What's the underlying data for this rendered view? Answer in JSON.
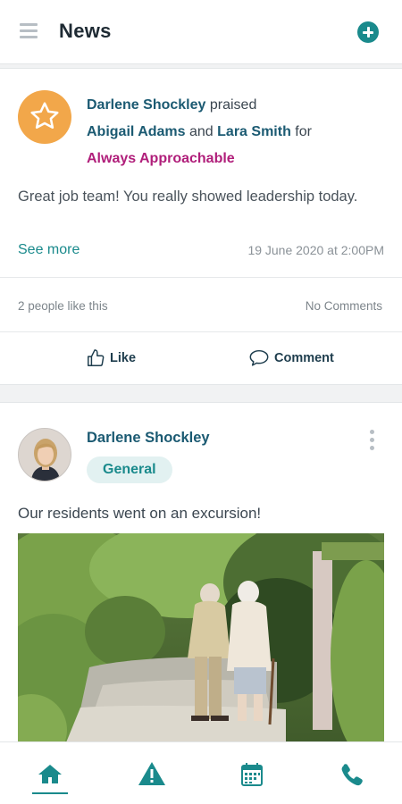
{
  "header": {
    "title": "News"
  },
  "post1": {
    "actor": "Darlene Shockley",
    "verb": "praised",
    "recipient1": "Abigail Adams",
    "conjunction": "and",
    "recipient2": "Lara Smith",
    "preposition": "for",
    "value": "Always Approachable",
    "body": "Great job team! You really showed leadership today.",
    "see_more": "See more",
    "timestamp": "19 June 2020 at 2:00PM",
    "likes": "2 people like this",
    "comments": "No Comments",
    "like_label": "Like",
    "comment_label": "Comment"
  },
  "post2": {
    "author": "Darlene Shockley",
    "tag": "General",
    "body": "Our residents went on an excursion!"
  },
  "colors": {
    "accent": "#1a8a8c",
    "name_link": "#1b5a72",
    "praise_value": "#b01e7a",
    "star_badge": "#f2a74a"
  },
  "icons": {
    "menu": "hamburger-icon",
    "add": "plus-circle-icon",
    "badge": "star-icon",
    "like": "thumbs-up-icon",
    "comment": "speech-bubble-icon",
    "more": "kebab-icon",
    "nav": [
      "home-icon",
      "alert-triangle-icon",
      "calendar-icon",
      "phone-icon"
    ]
  },
  "nav": {
    "active": "home"
  }
}
